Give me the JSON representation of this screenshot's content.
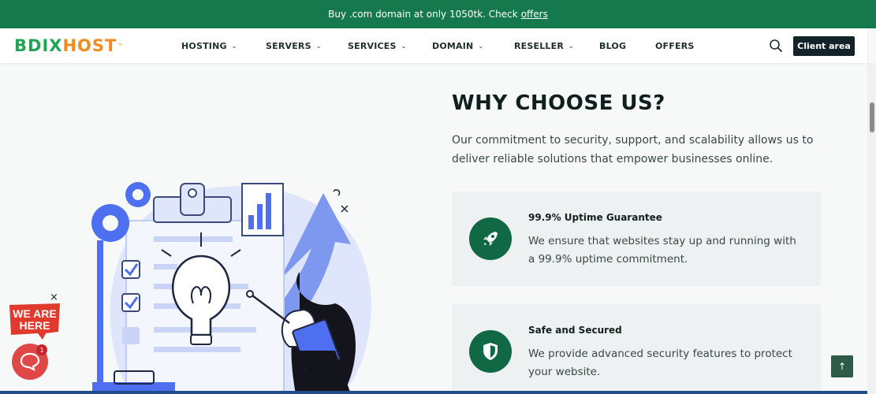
{
  "promo": {
    "text": "Buy .com domain at only 1050tk. Check",
    "link": "offers"
  },
  "brand": {
    "logo_part1": "BDIX",
    "logo_part2": "HOST",
    "logo_mark": "™"
  },
  "nav": {
    "items": [
      {
        "label": "HOSTING",
        "has_dropdown": true
      },
      {
        "label": "SERVERS",
        "has_dropdown": true
      },
      {
        "label": "SERVICES",
        "has_dropdown": true
      },
      {
        "label": "DOMAIN",
        "has_dropdown": true
      },
      {
        "label": "RESELLER",
        "has_dropdown": true
      },
      {
        "label": "BLOG",
        "has_dropdown": false
      },
      {
        "label": "OFFERS",
        "has_dropdown": false
      }
    ],
    "chevron_glyph": "⌄",
    "search_icon": "search-icon",
    "client_button": "Client area"
  },
  "section": {
    "heading": "WHY CHOOSE US?",
    "intro": "Our commitment to security, support, and scalability allows us to deliver reliable solutions that empower businesses online.",
    "features": [
      {
        "title": "99.9% Uptime Guarantee",
        "description": "We ensure that websites stay up and running with a 99.9% uptime commitment.",
        "icon": "rocket-icon"
      },
      {
        "title": "Safe and Secured",
        "description": "We provide advanced security features to protect your website.",
        "icon": "shield-icon"
      }
    ]
  },
  "widgets": {
    "badge_line1": "WE ARE",
    "badge_line2": "HERE",
    "badge_close": "×",
    "chat_count": "1",
    "back_to_top": "↑"
  },
  "colors": {
    "brand_green": "#16794d",
    "card_icon_green": "#106845",
    "client_button_bg": "#14222a",
    "illustration_blue": "#4d6ff0",
    "chat_red": "#e04848"
  }
}
